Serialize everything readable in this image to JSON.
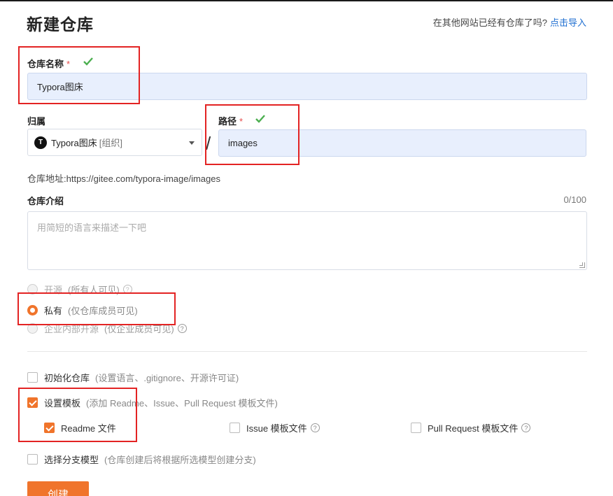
{
  "page": {
    "title": "新建仓库",
    "import_question": "在其他网站已经有仓库了吗?",
    "import_link": "点击导入"
  },
  "repo_name": {
    "label": "仓库名称",
    "required_mark": "*",
    "value": "Typora图床"
  },
  "owner": {
    "label": "归属",
    "badge_letter": "T",
    "value": "Typora图床",
    "tag": "[组织]"
  },
  "path": {
    "label": "路径",
    "required_mark": "*",
    "separator": "/",
    "value": "images"
  },
  "address": {
    "text": "仓库地址:https://gitee.com/typora-image/images"
  },
  "description": {
    "label": "仓库介绍",
    "counter": "0/100",
    "placeholder": "用简短的语言来描述一下吧"
  },
  "visibility": {
    "options": [
      {
        "label": "开源",
        "hint": "(所有人可见)",
        "selected": false,
        "disabled": true
      },
      {
        "label": "私有",
        "hint": "(仅仓库成员可见)",
        "selected": true,
        "disabled": false
      },
      {
        "label": "企业内部开源",
        "hint": "(仅企业成员可见)",
        "selected": false,
        "disabled": true
      }
    ]
  },
  "options": {
    "init_repo": {
      "label": "初始化仓库",
      "hint": "(设置语言、.gitignore、开源许可证)",
      "checked": false
    },
    "set_template": {
      "label": "设置模板",
      "hint": "(添加 Readme、Issue、Pull Request 模板文件)",
      "checked": true
    },
    "templates": [
      {
        "label": "Readme 文件",
        "checked": true
      },
      {
        "label": "Issue 模板文件",
        "checked": false
      },
      {
        "label": "Pull Request 模板文件",
        "checked": false
      }
    ],
    "branch_model": {
      "label": "选择分支模型",
      "hint": "(仓库创建后将根据所选模型创建分支)",
      "checked": false
    }
  },
  "create_button": "创建",
  "colors": {
    "accent": "#f0742b",
    "link": "#1f6fd1",
    "valid": "#4caf50",
    "annotation": "#e32323",
    "input_fill": "#e8effd"
  }
}
